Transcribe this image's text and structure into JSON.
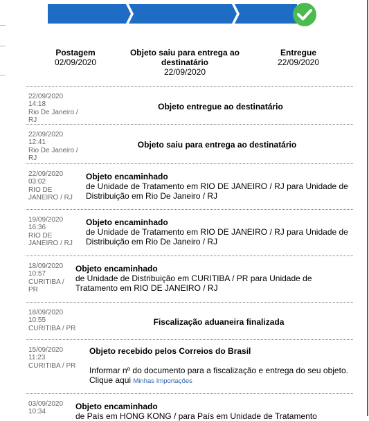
{
  "progress": {
    "steps_completed": 3,
    "steps_total": 3,
    "accent_color": "#1f6cc4",
    "check_color": "#4cbb4f",
    "check_icon": "check-circle-icon"
  },
  "milestones": [
    {
      "title": "Postagem",
      "date": "02/09/2020"
    },
    {
      "title": "Objeto saiu para entrega ao destinatário",
      "date": "22/09/2020"
    },
    {
      "title": "Entregue",
      "date": "22/09/2020"
    }
  ],
  "events": [
    {
      "date": "22/09/2020",
      "time": "14:18",
      "place": "Rio De Janeiro / RJ",
      "title": "Objeto entregue ao destinatário"
    },
    {
      "date": "22/09/2020",
      "time": "12:41",
      "place": "Rio De Janeiro / RJ",
      "title": "Objeto saiu para entrega ao destinatário"
    },
    {
      "date": "22/09/2020",
      "time": "03:02",
      "place": "RIO DE JANEIRO / RJ",
      "title": "Objeto encaminhado",
      "detail": "de Unidade de Tratamento em RIO DE JANEIRO / RJ para Unidade de Distribuição em Rio De Janeiro / RJ"
    },
    {
      "date": "19/09/2020",
      "time": "16:36",
      "place": "RIO DE JANEIRO / RJ",
      "title": "Objeto encaminhado",
      "detail": "de Unidade de Tratamento em RIO DE JANEIRO / RJ para Unidade de Distribuição em Rio De Janeiro / RJ"
    },
    {
      "date": "18/09/2020",
      "time": "10:57",
      "place": "CURITIBA / PR",
      "title": "Objeto encaminhado",
      "detail": "de Unidade de Distribuição em CURITIBA / PR para Unidade de Tratamento em RIO DE JANEIRO / RJ"
    },
    {
      "date": "18/09/2020",
      "time": "10:55",
      "place": "CURITIBA / PR",
      "title": "Fiscalização aduaneira finalizada"
    },
    {
      "date": "15/09/2020",
      "time": "11:23",
      "place": "CURITIBA / PR",
      "title": "Objeto recebido pelos Correios do Brasil",
      "detail": "Informar nº do documento para a fiscalização e entrega do seu objeto. Clique aqui",
      "link": "Minhas Importações"
    },
    {
      "date": "03/09/2020",
      "time": "10:34",
      "title": "Objeto encaminhado",
      "detail": "de País em HONG KONG / para País em Unidade de Tratamento"
    }
  ]
}
